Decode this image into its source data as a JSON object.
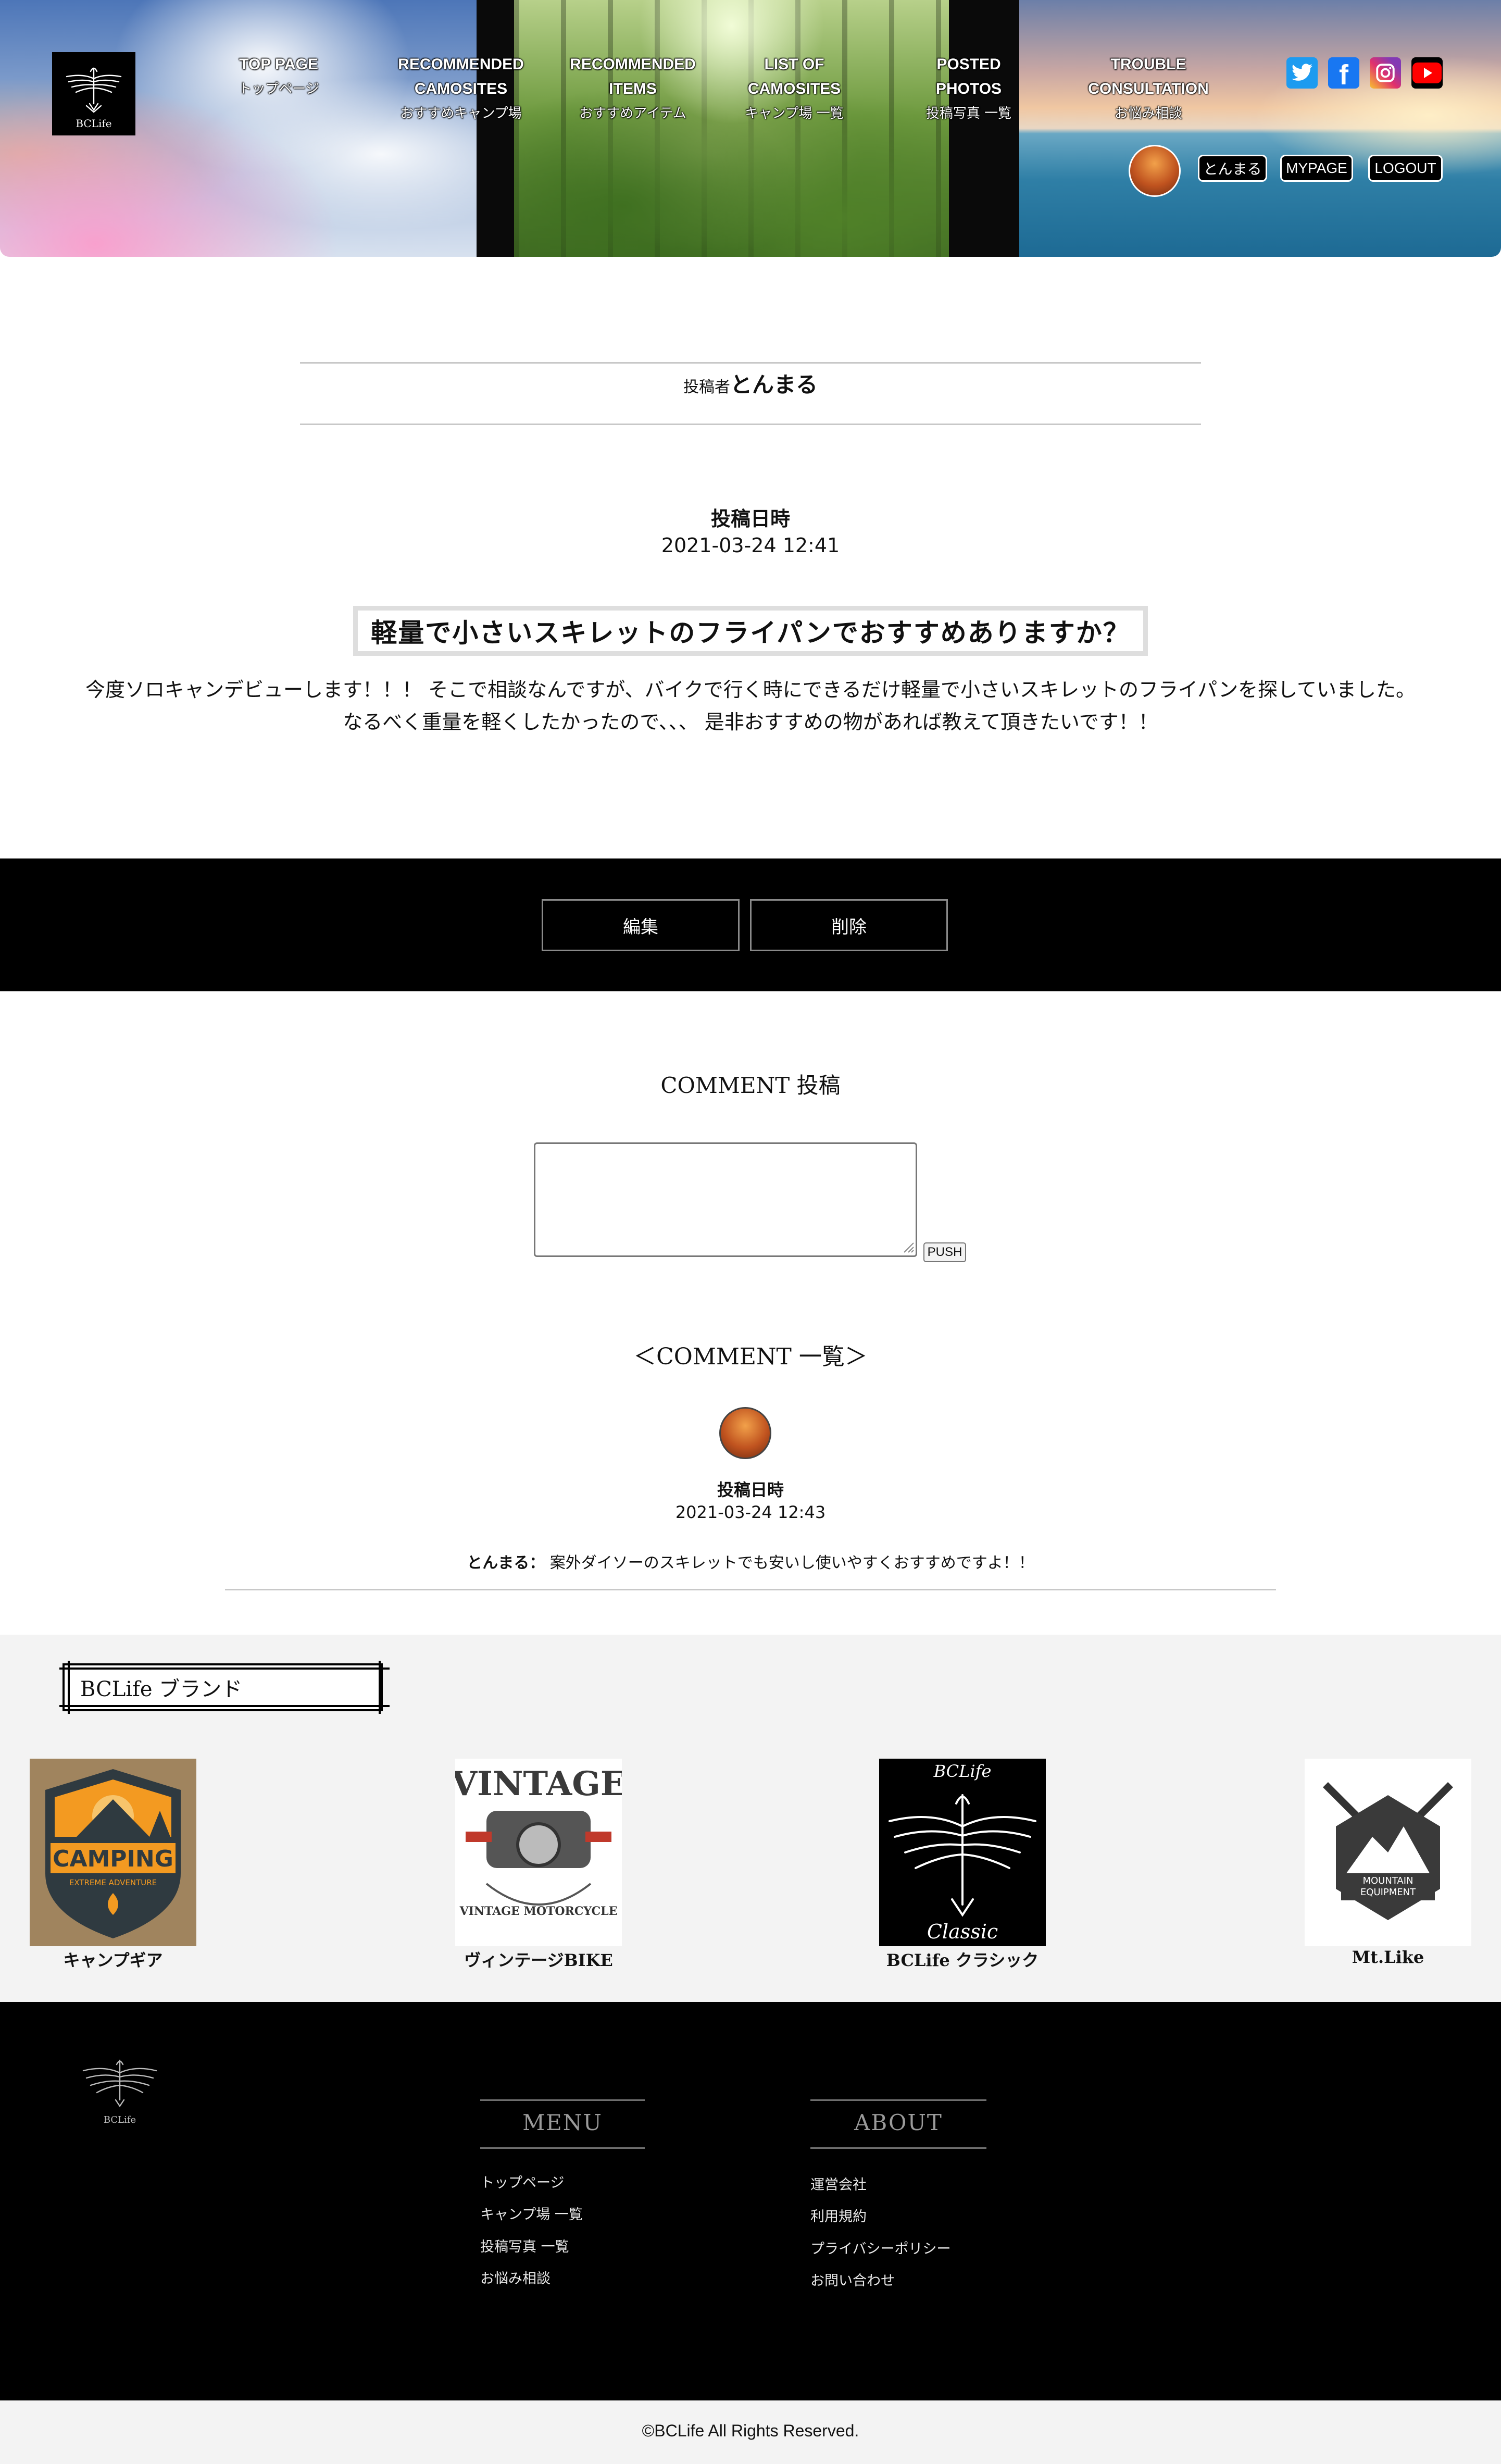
{
  "header": {
    "logo_text": "BCLife",
    "nav": [
      {
        "en": "TOP PAGE",
        "jp": "トップページ"
      },
      {
        "en": "RECOMMENDED CAMOSITES",
        "jp": "おすすめキャンプ場"
      },
      {
        "en": "RECOMMENDED ITEMS",
        "jp": "おすすめアイテム"
      },
      {
        "en": "LIST OF CAMOSITES",
        "jp": "キャンプ場 一覧"
      },
      {
        "en": "POSTED PHOTOS",
        "jp": "投稿写真 一覧"
      },
      {
        "en": "TROUBLE CONSULTATION",
        "jp": "お悩み相談"
      }
    ],
    "sns": [
      "twitter-icon",
      "facebook-icon",
      "instagram-icon",
      "youtube-icon"
    ],
    "user_name": "とんまる",
    "mypage_label": "MYPAGE",
    "logout_label": "LOGOUT"
  },
  "post": {
    "author_prefix": "投稿者",
    "author_name": "とんまる",
    "date_label": "投稿日時",
    "date": "2021-03-24 12:41",
    "title": "軽量で小さいスキレットのフライパンでおすすめありますか？",
    "body_line1": "今度ソロキャンデビューします！！！ そこで相談なんですが、バイクで行く時にできるだけ軽量で小さいスキレットのフライパンを探していました。",
    "body_line2": "なるべく重量を軽くしたかったので、、、 是非おすすめの物があれば教えて頂きたいです！！"
  },
  "actions": {
    "edit_label": "編集",
    "delete_label": "削除"
  },
  "comment_form": {
    "heading": "COMMENT 投稿",
    "textarea_value": "",
    "submit_label": "PUSH"
  },
  "comments": {
    "heading": "＜COMMENT 一覧＞",
    "items": [
      {
        "date_label": "投稿日時",
        "date": "2021-03-24 12:43",
        "author": "とんまる：",
        "text": "案外ダイソーのスキレットでも安いし使いやすくおすすめですよ！！"
      }
    ]
  },
  "brands": {
    "heading": "BCLife ブランド",
    "items": [
      {
        "label": "キャンプギア",
        "badge_main": "CAMPING",
        "badge_sub": "EXTREME ADVENTURE"
      },
      {
        "label": "ヴィンテージBIKE",
        "badge_main": "VINTAGE",
        "badge_sub": "VINTAGE MOTORCYCLE"
      },
      {
        "label": "BCLife クラシック",
        "badge_main": "BCLife",
        "badge_sub": "Classic"
      },
      {
        "label": "Mt.Like",
        "badge_main": "MOUNTAIN",
        "badge_sub": "EQUIPMENT"
      }
    ]
  },
  "footer": {
    "logo_text": "BCLife",
    "menu_heading": "MENU",
    "menu_links": [
      "トップページ",
      "キャンプ場 一覧",
      "投稿写真 一覧",
      "お悩み相談"
    ],
    "about_heading": "ABOUT",
    "about_links": [
      "運営会社",
      "利用規約",
      "プライバシーポリシー",
      "お問い合わせ"
    ],
    "copyright": "©BCLife All Rights Reserved."
  },
  "colors": {
    "accent_black": "#000000",
    "band_grey": "#f3f3f3",
    "divider_grey": "#c8c8c8",
    "twitter": "#1d9bf0",
    "facebook": "#1877f2",
    "youtube": "#ff0000"
  }
}
